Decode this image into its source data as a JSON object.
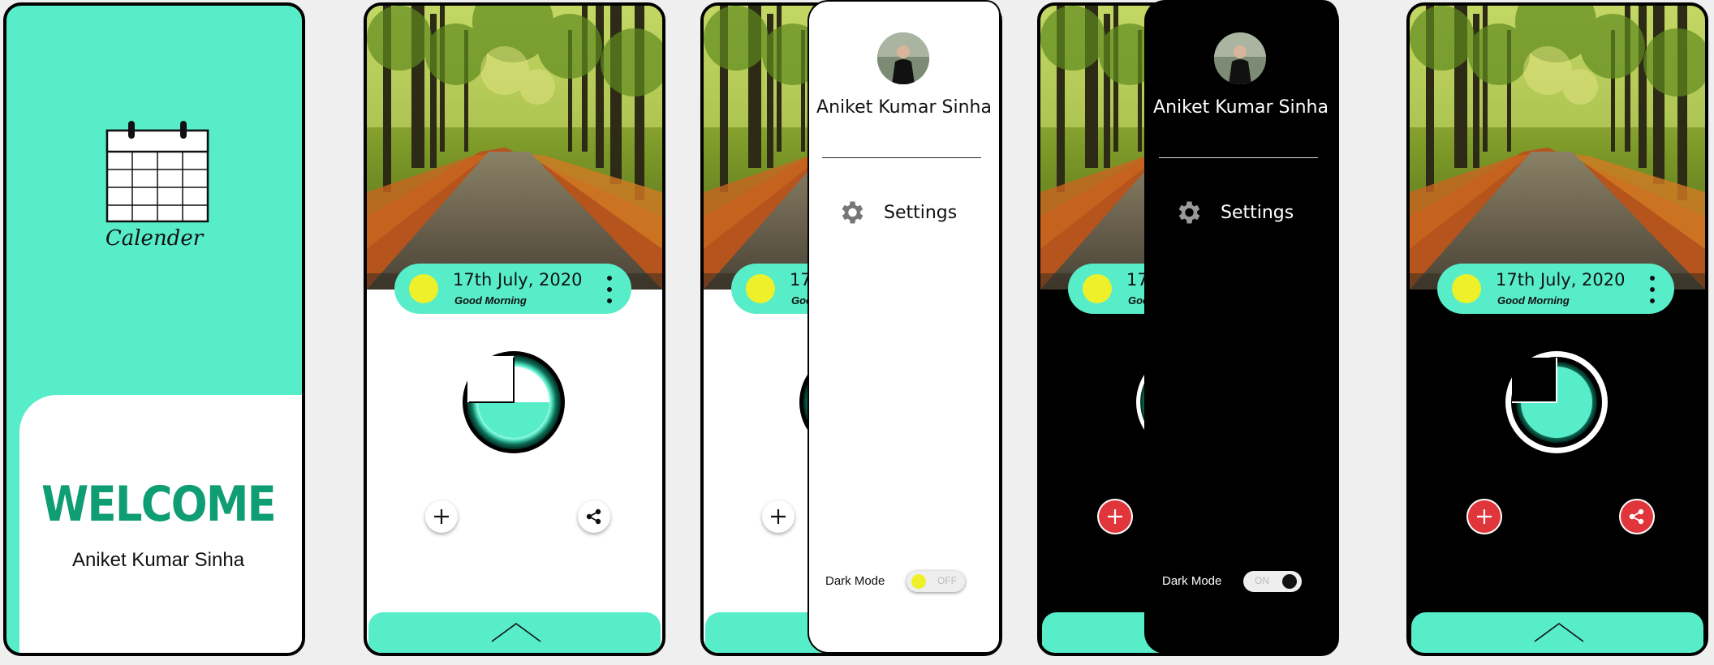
{
  "colors": {
    "accent": "#57edc9",
    "welcome_green": "#0f9d73",
    "sun": "#eef02a",
    "button_red": "#e0353a"
  },
  "splash": {
    "app_icon": "calendar-icon",
    "app_label": "Calender",
    "welcome_title": "WELCOME",
    "user_name": "Aniket Kumar Sinha"
  },
  "header": {
    "date": "17th July, 2020",
    "greeting": "Good Morning",
    "sun_icon": "sun-icon",
    "menu_icon": "more-vertical-icon"
  },
  "actions": {
    "add_icon": "plus-icon",
    "share_icon": "share-icon",
    "bottom_icon": "chevron-up-icon"
  },
  "drawer": {
    "user_name": "Aniket Kumar Sinha",
    "settings_label": "Settings",
    "settings_icon": "gear-icon",
    "dark_mode_label": "Dark Mode",
    "toggle_off_text": "OFF",
    "toggle_on_text": "ON"
  },
  "screens": [
    {
      "name": "splash"
    },
    {
      "name": "home-light"
    },
    {
      "name": "drawer-light",
      "dark_mode": false
    },
    {
      "name": "drawer-dark",
      "dark_mode": true
    },
    {
      "name": "home-dark"
    }
  ]
}
